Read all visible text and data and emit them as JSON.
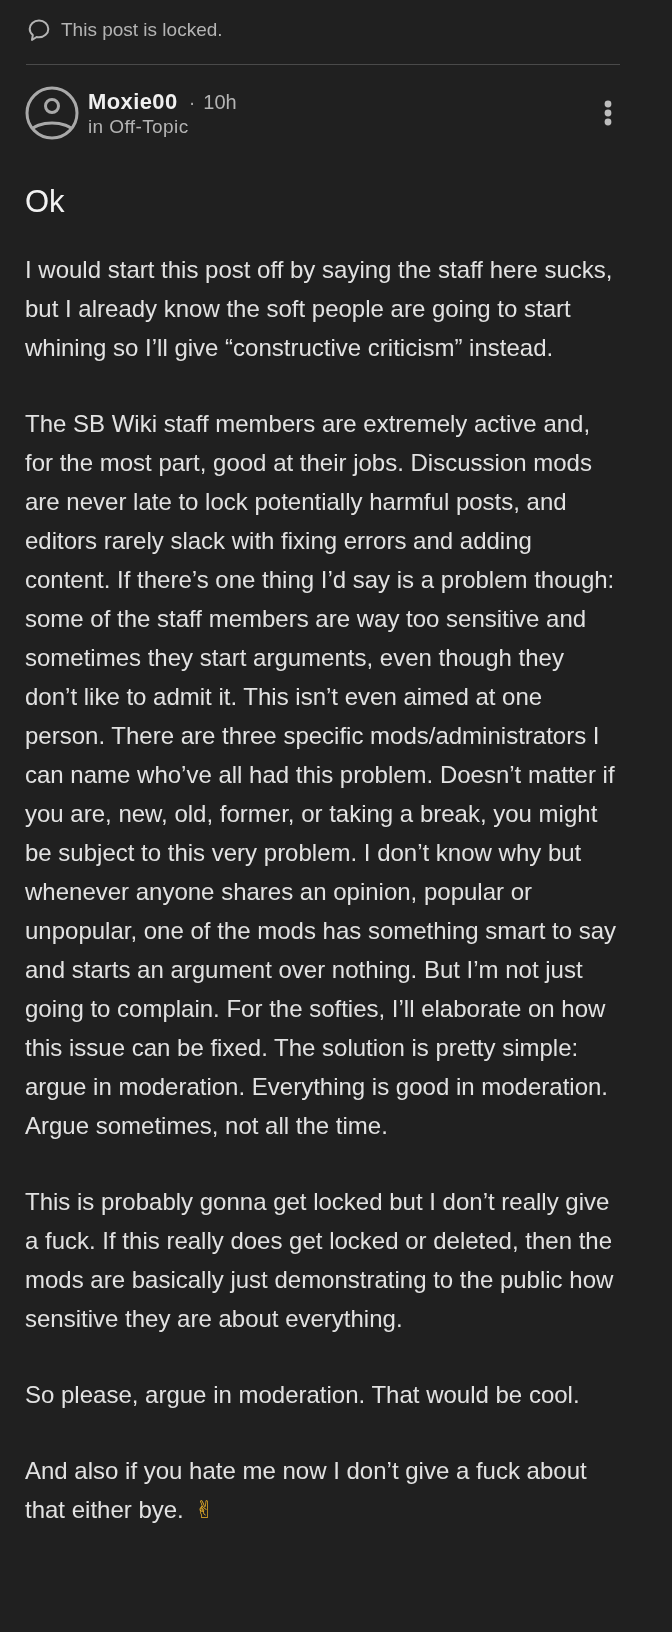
{
  "locked_notice": {
    "text": "This post is locked."
  },
  "post": {
    "author": "Moxie00",
    "separator": "·",
    "time": "10h",
    "category": "in Off-Topic",
    "title": "Ok",
    "paragraphs": [
      {
        "text": "I would start this post off by saying the staff here sucks, but I already know the soft people are going to start whining so I’ll give “constructive criticism” instead."
      },
      {
        "text": "The SB Wiki staff members are extremely active and, for the most part, good at their jobs. Discussion mods are never late to lock potentially harmful posts, and editors rarely slack with fixing errors and adding content. If there’s one thing I’d say is a problem though: some of the staff members are way too sensitive and sometimes they start arguments, even though they don’t like to admit it. This isn’t even aimed at one person. There are three specific mods/administrators I can name who’ve all had this problem. Doesn’t matter if you are, new, old, former, or taking a break, you might be subject to this very problem. I don’t know why but whenever anyone shares an opinion, popular or unpopular, one of the mods has something smart to say and starts an argument over nothing. But I’m not just going to complain. For the softies, I’ll elaborate on how this issue can be fixed. The solution is pretty simple: argue in moderation. Everything is good in moderation. Argue sometimes, not all the time."
      },
      {
        "text": "This is probably gonna get locked but I don’t really give a fuck. If this really does get locked or deleted, then the mods are basically just demonstrating to the public how sensitive they are about everything."
      },
      {
        "text": "So please, argue in moderation. That would be cool."
      },
      {
        "text": "And also if you hate me now I don’t give a fuck about that either bye.",
        "emoji": "✌"
      }
    ]
  }
}
